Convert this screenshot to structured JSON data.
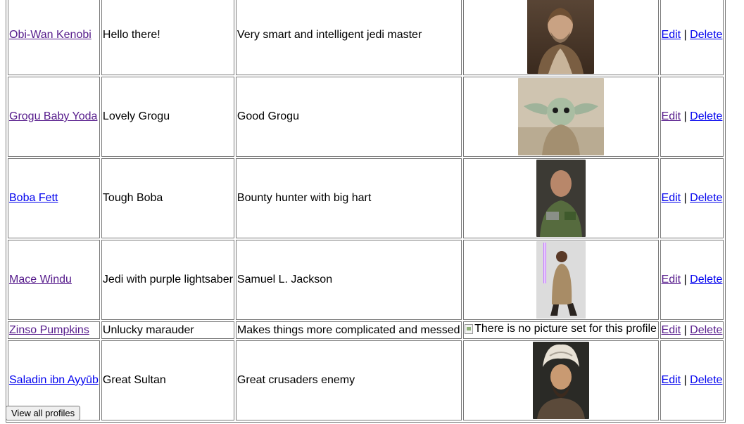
{
  "profiles": [
    {
      "name": "Obi-Wan Kenobi",
      "visited": true,
      "title": "Hello there!",
      "description": "Very smart and intelligent jedi master",
      "picture": "obi-wan",
      "edit": "Edit",
      "delete": "Delete"
    },
    {
      "name": "Grogu Baby Yoda",
      "visited": true,
      "title": "Lovely Grogu",
      "description": "Good Grogu",
      "picture": "grogu",
      "edit": "Edit",
      "delete": "Delete"
    },
    {
      "name": "Boba Fett",
      "visited": false,
      "title": "Tough Boba",
      "description": "Bounty hunter with big hart",
      "picture": "boba",
      "edit": "Edit",
      "delete": "Delete"
    },
    {
      "name": "Mace Windu",
      "visited": true,
      "title": "Jedi with purple lightsaber",
      "description": "Samuel L. Jackson",
      "picture": "mace",
      "edit": "Edit",
      "delete": "Delete"
    },
    {
      "name": "Zinso Pumpkins",
      "visited": true,
      "title": "Unlucky marauder",
      "description": "Makes things more complicated and messed",
      "picture_alt": "There is no picture set for this profile",
      "edit": "Edit",
      "delete": "Delete"
    },
    {
      "name": "Saladin ibn Ayyūb",
      "visited": false,
      "title": "Great Sultan",
      "description": "Great crusaders enemy",
      "picture": "saladin",
      "edit": "Edit",
      "delete": "Delete"
    }
  ],
  "action_separator": "|",
  "view_all_button": "View all profiles"
}
